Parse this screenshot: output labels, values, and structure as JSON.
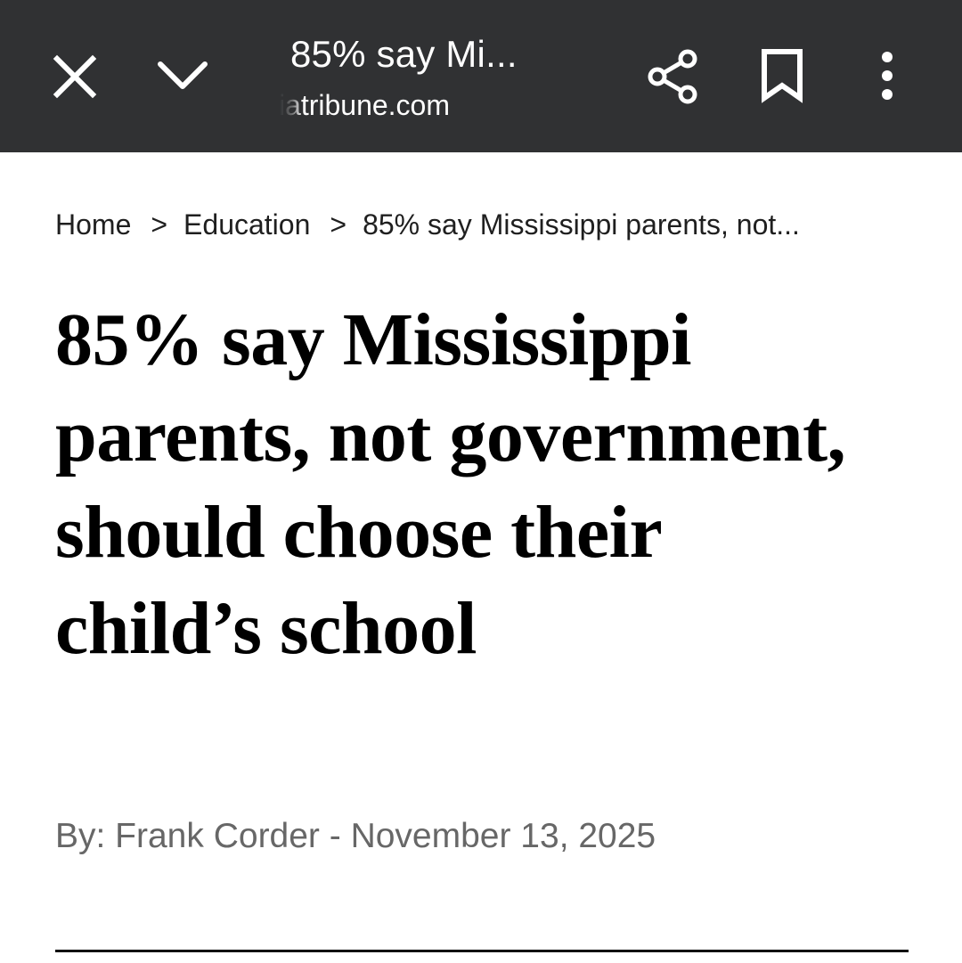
{
  "toolbar": {
    "title": "85% say Mi...",
    "domain": "aliatribune.com",
    "close_icon": "close-icon",
    "chevron_icon": "chevron-down-icon",
    "share_icon": "share-icon",
    "bookmark_icon": "bookmark-icon",
    "more_icon": "more-vert-icon"
  },
  "breadcrumb": {
    "items": [
      "Home",
      "Education",
      "85% say Mississippi parents, not..."
    ],
    "separator": ">"
  },
  "article": {
    "headline": "85% say Mississippi parents, not government, should choose their child’s school",
    "byline": "By: Frank Corder - November 13, 2025"
  },
  "colors": {
    "toolbar_bg": "#303133",
    "byline": "#676767",
    "headline": "#000000"
  }
}
